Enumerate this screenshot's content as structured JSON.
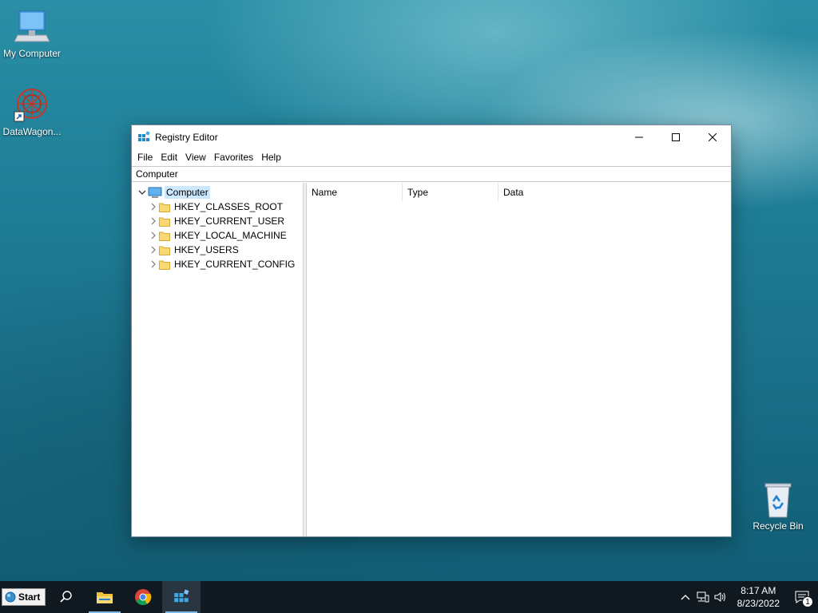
{
  "desktop": {
    "icons": [
      {
        "label": "My Computer",
        "icon": "computer-icon"
      },
      {
        "label": "DataWagon...",
        "icon": "datawagon-icon"
      },
      {
        "label": "Recycle Bin",
        "icon": "recycle-bin-icon"
      }
    ]
  },
  "window": {
    "title": "Registry Editor",
    "icon": "registry-editor-icon",
    "menu": [
      "File",
      "Edit",
      "View",
      "Favorites",
      "Help"
    ],
    "address": "Computer",
    "tree": {
      "root": "Computer",
      "children": [
        "HKEY_CLASSES_ROOT",
        "HKEY_CURRENT_USER",
        "HKEY_LOCAL_MACHINE",
        "HKEY_USERS",
        "HKEY_CURRENT_CONFIG"
      ]
    },
    "columns": [
      "Name",
      "Type",
      "Data"
    ]
  },
  "taskbar": {
    "start_label": "Start",
    "items": [
      "search-icon",
      "file-explorer-icon",
      "chrome-icon",
      "registry-editor-icon"
    ],
    "clock_time": "8:17 AM",
    "clock_date": "8/23/2022",
    "notification_count": "1"
  }
}
